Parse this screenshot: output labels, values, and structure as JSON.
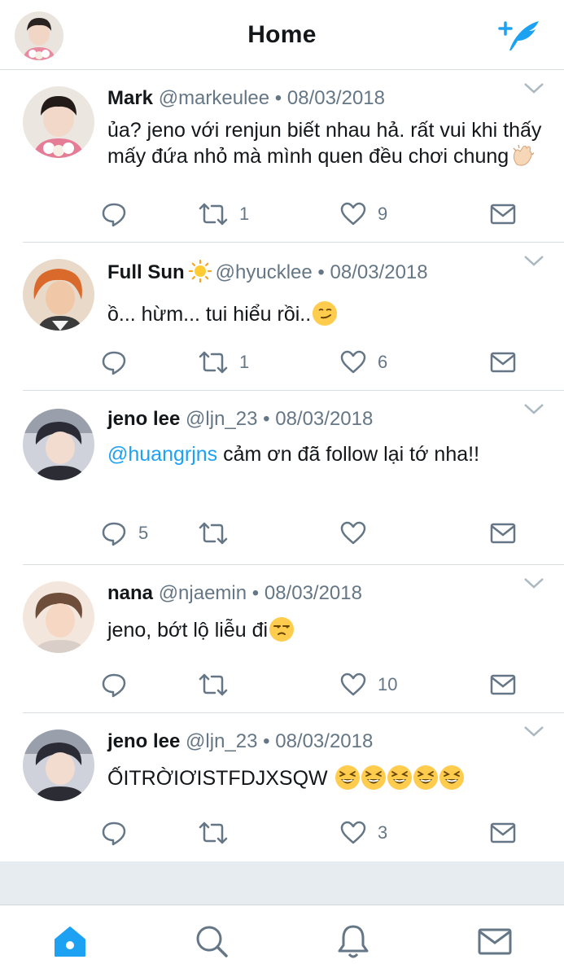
{
  "header": {
    "title": "Home",
    "avatar_icon": "user-avatar",
    "compose_icon": "compose-feather-icon",
    "accent": "#1da1f2"
  },
  "tweets": [
    {
      "name": "Mark",
      "handle": "@markeulee",
      "date": "08/03/2018",
      "text": "ủa? jeno với renjun biết nhau hả. rất vui khi thấy mấy đứa nhỏ mà mình quen đều chơi chung",
      "emoji": "clapping-hands-emoji",
      "replies": "",
      "retweets": "1",
      "likes": "9"
    },
    {
      "name": "Full Sun",
      "name_emoji": "sun-emoji",
      "handle": "@hyucklee",
      "date": "08/03/2018",
      "text": "ồ... hừm... tui hiểu rồi..",
      "emoji": "smirking-face-emoji",
      "replies": "",
      "retweets": "1",
      "likes": "6"
    },
    {
      "name": "jeno lee",
      "handle": "@ljn_23",
      "date": "08/03/2018",
      "mention": "@huangrjns",
      "text": " cảm ơn đã follow lại tớ nha!!",
      "replies": "5",
      "retweets": "",
      "likes": ""
    },
    {
      "name": "nana",
      "handle": "@njaemin",
      "date": "08/03/2018",
      "text": "jeno, bớt lộ liễu đi",
      "emoji": "unamused-face-emoji",
      "replies": "",
      "retweets": "",
      "likes": "10"
    },
    {
      "name": "jeno lee",
      "handle": "@ljn_23",
      "date": "08/03/2018",
      "text": "ỐITRỜIƠISTFDJXSQW",
      "emoji": "grinning-squinting-face-emoji x5",
      "replies": "",
      "retweets": "",
      "likes": "3"
    }
  ],
  "tabbar": {
    "items": [
      "home-icon",
      "search-icon",
      "notifications-icon",
      "messages-icon"
    ],
    "active": "home-icon"
  },
  "separator": " • "
}
